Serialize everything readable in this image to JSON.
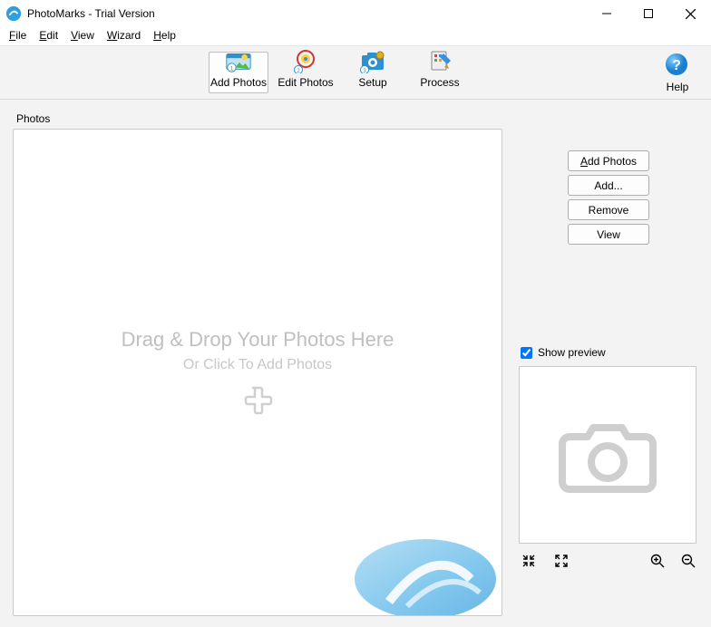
{
  "window": {
    "title": "PhotoMarks - Trial Version"
  },
  "menu": {
    "file": "File",
    "edit": "Edit",
    "view": "View",
    "wizard": "Wizard",
    "help": "Help"
  },
  "toolbar": {
    "add_photos": "Add Photos",
    "edit_photos": "Edit Photos",
    "setup": "Setup",
    "process": "Process",
    "help": "Help"
  },
  "photos_section_label": "Photos",
  "dropzone": {
    "title": "Drag & Drop Your Photos Here",
    "subtitle": "Or Click To Add Photos"
  },
  "side": {
    "add_photos": "Add Photos",
    "add_more": "Add...",
    "remove": "Remove",
    "view": "View",
    "show_preview": "Show preview",
    "show_preview_checked": true
  },
  "preview_controls": {
    "fit": "fit-screen",
    "fullscreen": "fullscreen",
    "zoom_in": "zoom-in",
    "zoom_out": "zoom-out"
  }
}
